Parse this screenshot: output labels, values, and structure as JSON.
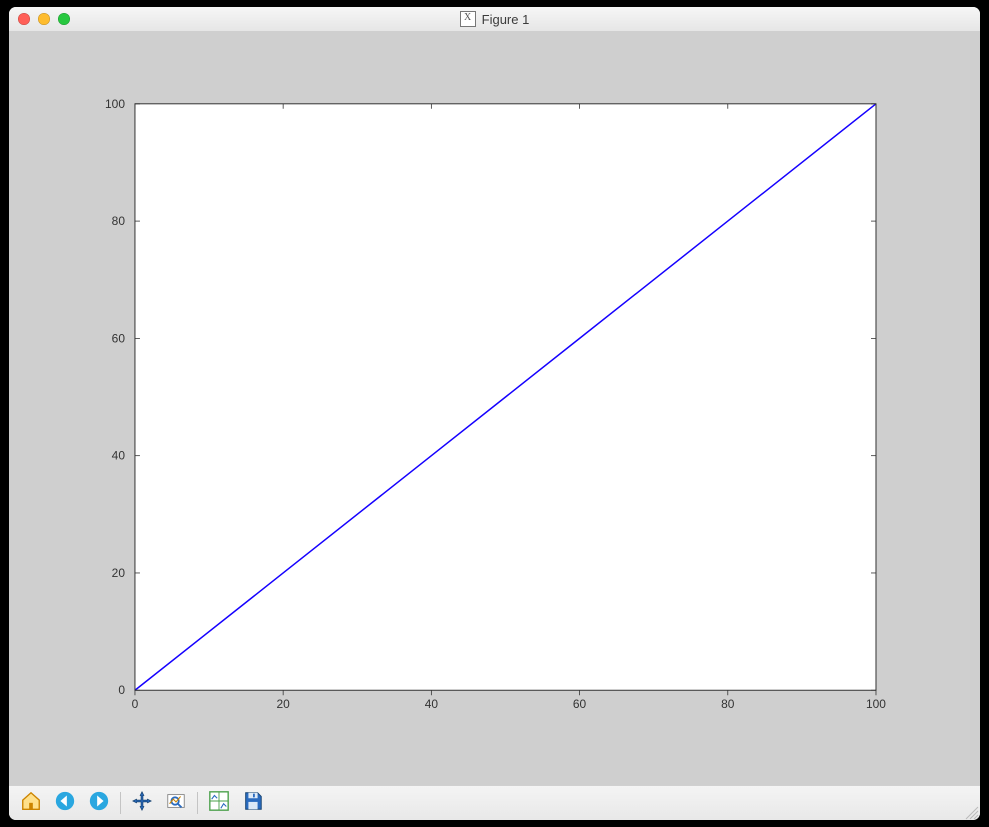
{
  "window": {
    "title": "Figure 1",
    "icon_label": "X"
  },
  "chart_data": {
    "type": "line",
    "x": [
      0,
      20,
      40,
      60,
      80,
      100
    ],
    "values": [
      0,
      20,
      40,
      60,
      80,
      100
    ],
    "title": "",
    "xlabel": "",
    "ylabel": "",
    "xlim": [
      0,
      100
    ],
    "ylim": [
      0,
      100
    ],
    "xticks": [
      0,
      20,
      40,
      60,
      80,
      100
    ],
    "yticks": [
      0,
      20,
      40,
      60,
      80,
      100
    ],
    "line_color": "#1500ff"
  },
  "toolbar": {
    "items": [
      {
        "name": "home-icon",
        "label": "Home"
      },
      {
        "name": "back-icon",
        "label": "Back"
      },
      {
        "name": "forward-icon",
        "label": "Forward"
      },
      {
        "sep": true
      },
      {
        "name": "pan-icon",
        "label": "Pan"
      },
      {
        "name": "zoom-icon",
        "label": "Zoom"
      },
      {
        "sep": true
      },
      {
        "name": "subplots-icon",
        "label": "Configure subplots"
      },
      {
        "name": "save-icon",
        "label": "Save"
      }
    ]
  }
}
